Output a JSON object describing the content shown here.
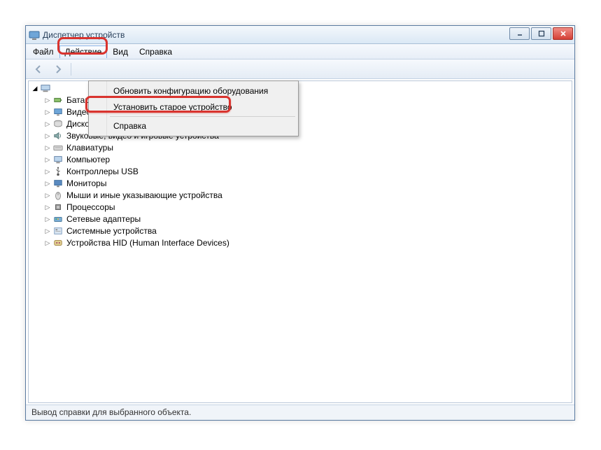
{
  "window": {
    "title": "Диспетчер устройств"
  },
  "menubar": {
    "file": "Файл",
    "action": "Действие",
    "view": "Вид",
    "help": "Справка"
  },
  "dropdown": {
    "refresh": "Обновить конфигурацию оборудования",
    "install_legacy": "Установить старое устройство",
    "help": "Справка"
  },
  "tree": {
    "items": [
      {
        "label": "Батареи",
        "icon": "battery"
      },
      {
        "label": "Видеоадаптеры",
        "icon": "display"
      },
      {
        "label": "Дисковые устройства",
        "icon": "disk"
      },
      {
        "label": "Звуковые, видео и игровые устройства",
        "icon": "sound"
      },
      {
        "label": "Клавиатуры",
        "icon": "keyboard"
      },
      {
        "label": "Компьютер",
        "icon": "computer"
      },
      {
        "label": "Контроллеры USB",
        "icon": "usb"
      },
      {
        "label": "Мониторы",
        "icon": "monitor"
      },
      {
        "label": "Мыши и иные указывающие устройства",
        "icon": "mouse"
      },
      {
        "label": "Процессоры",
        "icon": "cpu"
      },
      {
        "label": "Сетевые адаптеры",
        "icon": "network"
      },
      {
        "label": "Системные устройства",
        "icon": "system"
      },
      {
        "label": "Устройства HID (Human Interface Devices)",
        "icon": "hid"
      }
    ]
  },
  "statusbar": {
    "text": "Вывод справки для выбранного объекта."
  }
}
